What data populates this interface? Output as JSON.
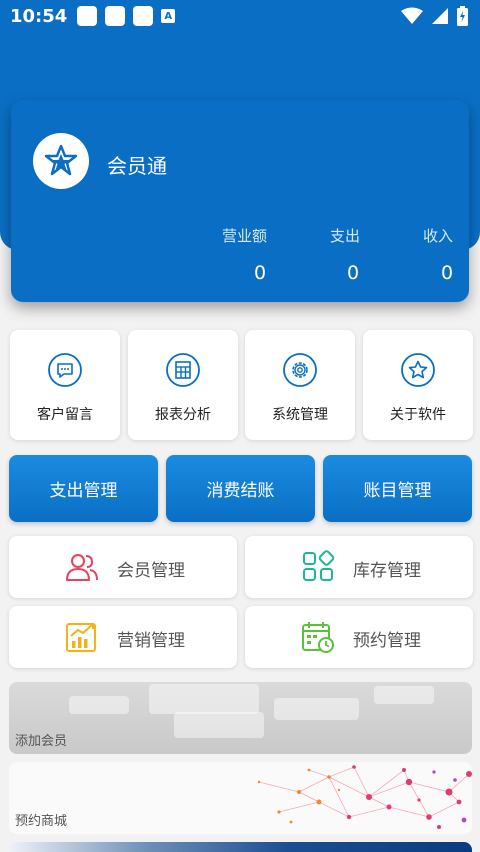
{
  "status_bar": {
    "time": "10:54",
    "keyboard_badge": "A"
  },
  "card": {
    "title": "会员通",
    "stats": [
      {
        "label": "营业额",
        "value": "0"
      },
      {
        "label": "支出",
        "value": "0"
      },
      {
        "label": "收入",
        "value": "0"
      }
    ]
  },
  "tiles": [
    {
      "label": "客户留言",
      "icon": "message-icon"
    },
    {
      "label": "报表分析",
      "icon": "report-icon"
    },
    {
      "label": "系统管理",
      "icon": "gear-icon"
    },
    {
      "label": "关于软件",
      "icon": "star-icon"
    }
  ],
  "blue_buttons": [
    {
      "label": "支出管理"
    },
    {
      "label": "消费结账"
    },
    {
      "label": "账目管理"
    }
  ],
  "management": [
    {
      "label": "会员管理",
      "icon": "members-icon",
      "color": "#e5455c"
    },
    {
      "label": "库存管理",
      "icon": "inventory-icon",
      "color": "#1bb79a"
    },
    {
      "label": "营销管理",
      "icon": "marketing-chart-icon",
      "color": "#f2b21a"
    },
    {
      "label": "预约管理",
      "icon": "calendar-clock-icon",
      "color": "#57c23a"
    }
  ],
  "banners": [
    {
      "label": "添加会员"
    },
    {
      "label": "预约商城"
    }
  ],
  "colors": {
    "primary": "#0a6fc4",
    "background": "#f2f2f2"
  }
}
